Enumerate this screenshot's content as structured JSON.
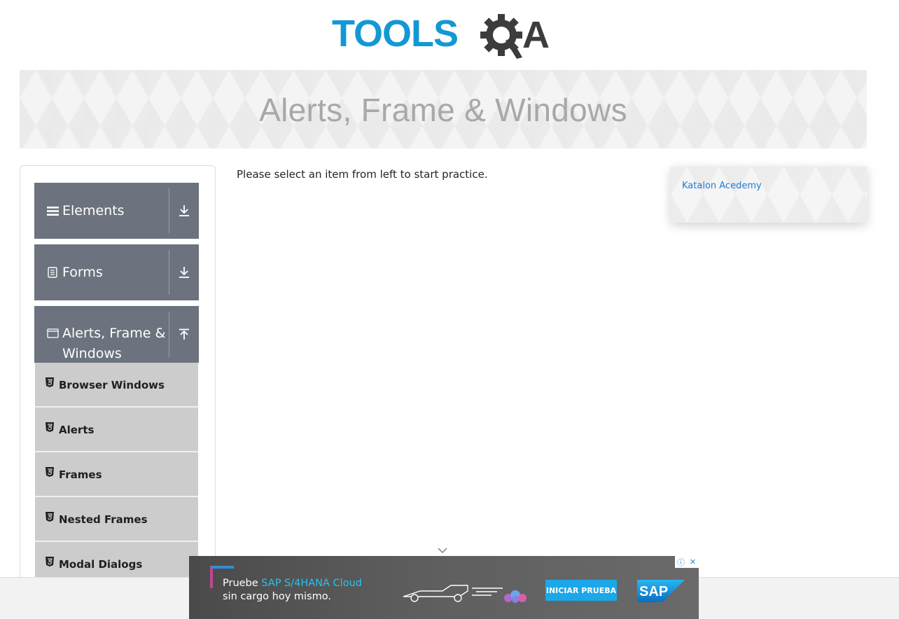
{
  "logo": {
    "text_part1": "TOOLS",
    "text_part2": "A",
    "primary_color": "#1398d4",
    "secondary_color": "#3c3c3c"
  },
  "banner": {
    "title": "Alerts, Frame & Windows"
  },
  "sidebar": {
    "groups": [
      {
        "label": "Elements",
        "icon": "menu-bars-icon",
        "arrow": "download-arrow-icon"
      },
      {
        "label": "Forms",
        "icon": "document-icon",
        "arrow": "download-arrow-icon"
      },
      {
        "label": "Alerts, Frame &",
        "label2": "Windows",
        "icon": "window-icon",
        "arrow": "upload-arrow-icon"
      }
    ],
    "items": [
      {
        "label": "Browser Windows",
        "icon": "html5-icon"
      },
      {
        "label": "Alerts",
        "icon": "html5-icon"
      },
      {
        "label": "Frames",
        "icon": "html5-icon"
      },
      {
        "label": "Nested Frames",
        "icon": "html5-icon"
      },
      {
        "label": "Modal Dialogs",
        "icon": "html5-icon"
      }
    ]
  },
  "main": {
    "instruction": "Please select an item from left to start practice."
  },
  "right_card": {
    "link": "Katalon Acedemy"
  },
  "ad": {
    "line1_prefix": "Pruebe ",
    "line1_highlight": "SAP S/4HANA Cloud",
    "line2": "sin cargo hoy mismo.",
    "cta": "INICIAR PRUEBA",
    "brand": "SAP",
    "info_symbol": "ⓘ",
    "close_symbol": "✕",
    "accent_color": "#1ca7e8"
  }
}
